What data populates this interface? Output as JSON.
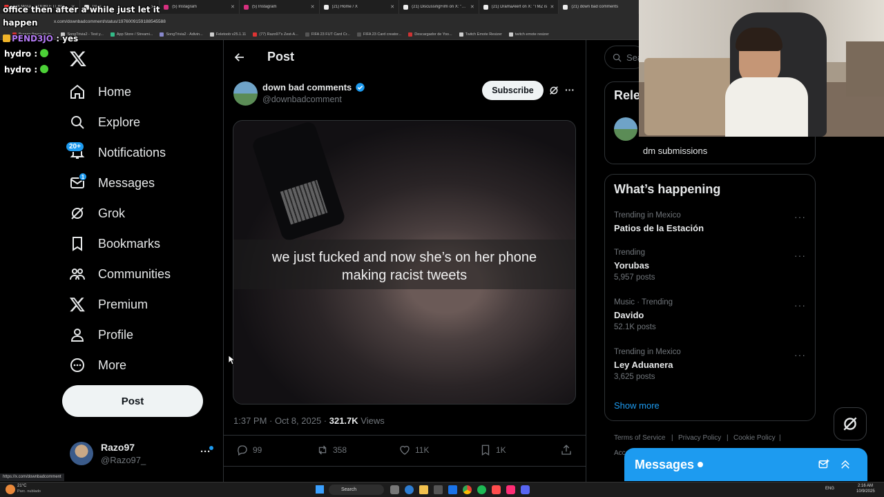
{
  "browser": {
    "tabs": [
      {
        "label": "(50) Mosa - DOUBLE IT BROTHER"
      },
      {
        "label": "Grok"
      },
      {
        "label": "(5) Instagram"
      },
      {
        "label": "(5) Instagram"
      },
      {
        "label": "(21) Home / X"
      },
      {
        "label": "(21) DiscussingFilm on X: \"Netfl"
      },
      {
        "label": "(21) DramaAlert on X: \"TMZ is"
      },
      {
        "label": "(21) down bad comments"
      }
    ],
    "url": "x.com/downbadcomment/status/1976009159188545588",
    "bookmarks": [
      "Burago figura de to...",
      "SongTrivia2 - Test y...",
      "App Store / Streami...",
      "SongTrivia2 - Adivin...",
      "Feletoob v25.1.11",
      "(77) Razo97's Zest-A...",
      "FIFA 23 FUT Card Cr...",
      "FIFA 23 Card creator...",
      "Descargador de Yoo...",
      "Twitch Emote Resizer",
      "twitch emote resizer"
    ],
    "status_url": "https://x.com/downbadcomment"
  },
  "chat_overlay": {
    "line1": "office then after a while just let it",
    "line2": "happen",
    "msgs": [
      {
        "user": "PEND3JO",
        "text": ": yes"
      },
      {
        "user": "hydro",
        "text": ":"
      },
      {
        "user": "hydro",
        "text": ":"
      }
    ]
  },
  "nav": {
    "home": "Home",
    "explore": "Explore",
    "notifications": "Notifications",
    "notifications_badge": "20+",
    "messages": "Messages",
    "messages_badge": "1",
    "grok": "Grok",
    "bookmarks": "Bookmarks",
    "communities": "Communities",
    "premium": "Premium",
    "profile": "Profile",
    "more": "More",
    "post_button": "Post"
  },
  "account": {
    "name": "Razo97",
    "handle": "@Razo97_"
  },
  "post": {
    "header": "Post",
    "author_name": "down bad comments",
    "author_handle": "@downbadcomment",
    "subscribe": "Subscribe",
    "caption_line1": "we just fucked and now she’s on her phone",
    "caption_line2": "making racist tweets",
    "timestamp": "1:37 PM · Oct 8, 2025 · ",
    "views_count": "321.7K",
    "views_label": " Views",
    "replies": "99",
    "reposts": "358",
    "likes": "11K",
    "bookmarks": "1K"
  },
  "sidebar": {
    "search_placeholder": "Sea",
    "relevant_title": "Rele",
    "relevant_bio": "dm submissions",
    "happening_title": "What’s happening",
    "trends": [
      {
        "context": "Trending in Mexico",
        "name": "Patios de la Estación",
        "count": ""
      },
      {
        "context": "Trending",
        "name": "Yorubas",
        "count": "5,957 posts"
      },
      {
        "context": "Music · Trending",
        "name": "Davido",
        "count": "52.1K posts"
      },
      {
        "context": "Trending in Mexico",
        "name": "Ley Aduanera",
        "count": "3,625 posts"
      }
    ],
    "show_more": "Show more",
    "footer": [
      "Terms of Service",
      "Privacy Policy",
      "Cookie Policy"
    ],
    "footer_more": "Acce",
    "messages_drawer": "Messages"
  },
  "taskbar": {
    "weather_temp": "21°C",
    "weather_desc": "Parc. nublado",
    "search": "Search",
    "lang": "ENG",
    "time": "2:16 AM",
    "date": "10/9/2025"
  },
  "colors": {
    "accent": "#1d9bf0",
    "bg": "#000000",
    "border": "#2f3336",
    "muted": "#71767b"
  }
}
